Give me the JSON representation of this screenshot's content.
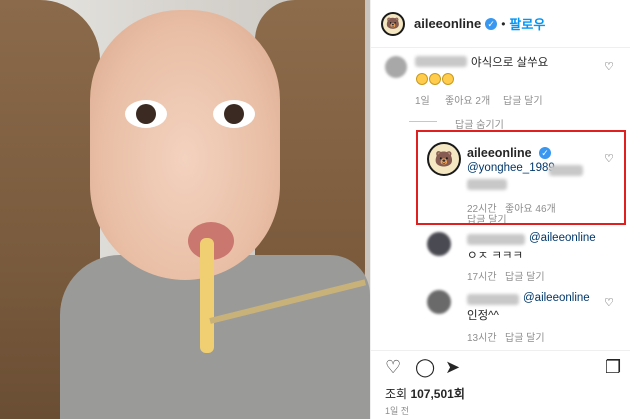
{
  "post_image": {
    "description_alt": ""
  },
  "header": {
    "username": "aileeonline",
    "verified_badge": "✓",
    "separator": "•",
    "follow_label": "팔로우"
  },
  "comments": [
    {
      "username": "",
      "text": "야식으로 살쑤요",
      "emoji_count": 3,
      "time": "1일",
      "likes": "좋아요 2개",
      "reply": "답글 달기"
    }
  ],
  "hide_replies_label": "답글 숨기기",
  "highlighted_reply": {
    "username": "aileeonline",
    "mention": "@yonghee_1989",
    "time": "22시간",
    "likes": "좋아요 46개",
    "reply": "답글 달기"
  },
  "replies": [
    {
      "mention": "@aileeonline",
      "text": "ㅇㅈ ㅋㅋㅋ",
      "time": "17시간",
      "reply": "답글 달기"
    },
    {
      "mention": "@aileeonline",
      "text": "인정^^",
      "time": "13시간",
      "reply": "답글 달기"
    }
  ],
  "footer": {
    "views_label": "조회",
    "views_count": "107,501회",
    "posted_ago": "1일 전"
  },
  "icons": {
    "heart": "♡",
    "comment": "◯",
    "share": "➤",
    "bookmark": "❐"
  },
  "colors": {
    "accent": "#0095f6",
    "highlight_border": "#e02020",
    "meta_text": "#8e8e8e"
  }
}
